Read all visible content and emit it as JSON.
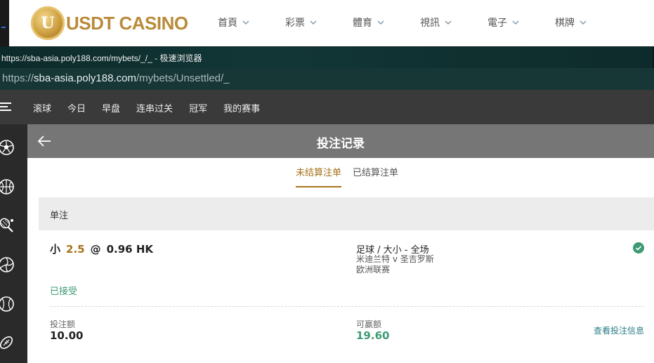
{
  "site": {
    "logo_text": "USDT CASINO",
    "nav": [
      "首頁",
      "彩票",
      "體育",
      "視訊",
      "電子",
      "棋牌"
    ]
  },
  "browser": {
    "window_title": "https://sba-asia.poly188.com/mybets/_/_ - 极速浏览器",
    "url_scheme": "https://",
    "url_host": "sba-asia.poly188.com",
    "url_path": "/mybets/Unsettled/_"
  },
  "sport_menu": {
    "tabs": [
      "滚球",
      "今日",
      "早盘",
      "连串过关",
      "冠军",
      "我的赛事"
    ]
  },
  "sidebar": {
    "icons": [
      "soccer-icon",
      "basketball-icon",
      "tennis-icon",
      "volleyball-icon",
      "baseball-icon",
      "football-icon"
    ]
  },
  "page": {
    "title": "投注记录",
    "tabs": {
      "unsettled": "未结算注单",
      "settled": "已结算注单"
    },
    "section_title": "单注"
  },
  "bet": {
    "selection": "小",
    "line": "2.5",
    "at": "@",
    "odds": "0.96 HK",
    "market": "足球 / 大小 - 全场",
    "match": "米迪兰特 v 圣吉罗斯",
    "league": "欧洲联赛",
    "status": "已接受",
    "stake_label": "投注额",
    "stake": "10.00",
    "win_label": "可赢额",
    "win": "19.60",
    "view_info": "查看投注信息"
  },
  "colors": {
    "accent": "#a6721a",
    "success": "#3d9a74",
    "link": "#2b7d86",
    "header_gray": "#767676",
    "menu_dark": "#3a3a3a"
  }
}
